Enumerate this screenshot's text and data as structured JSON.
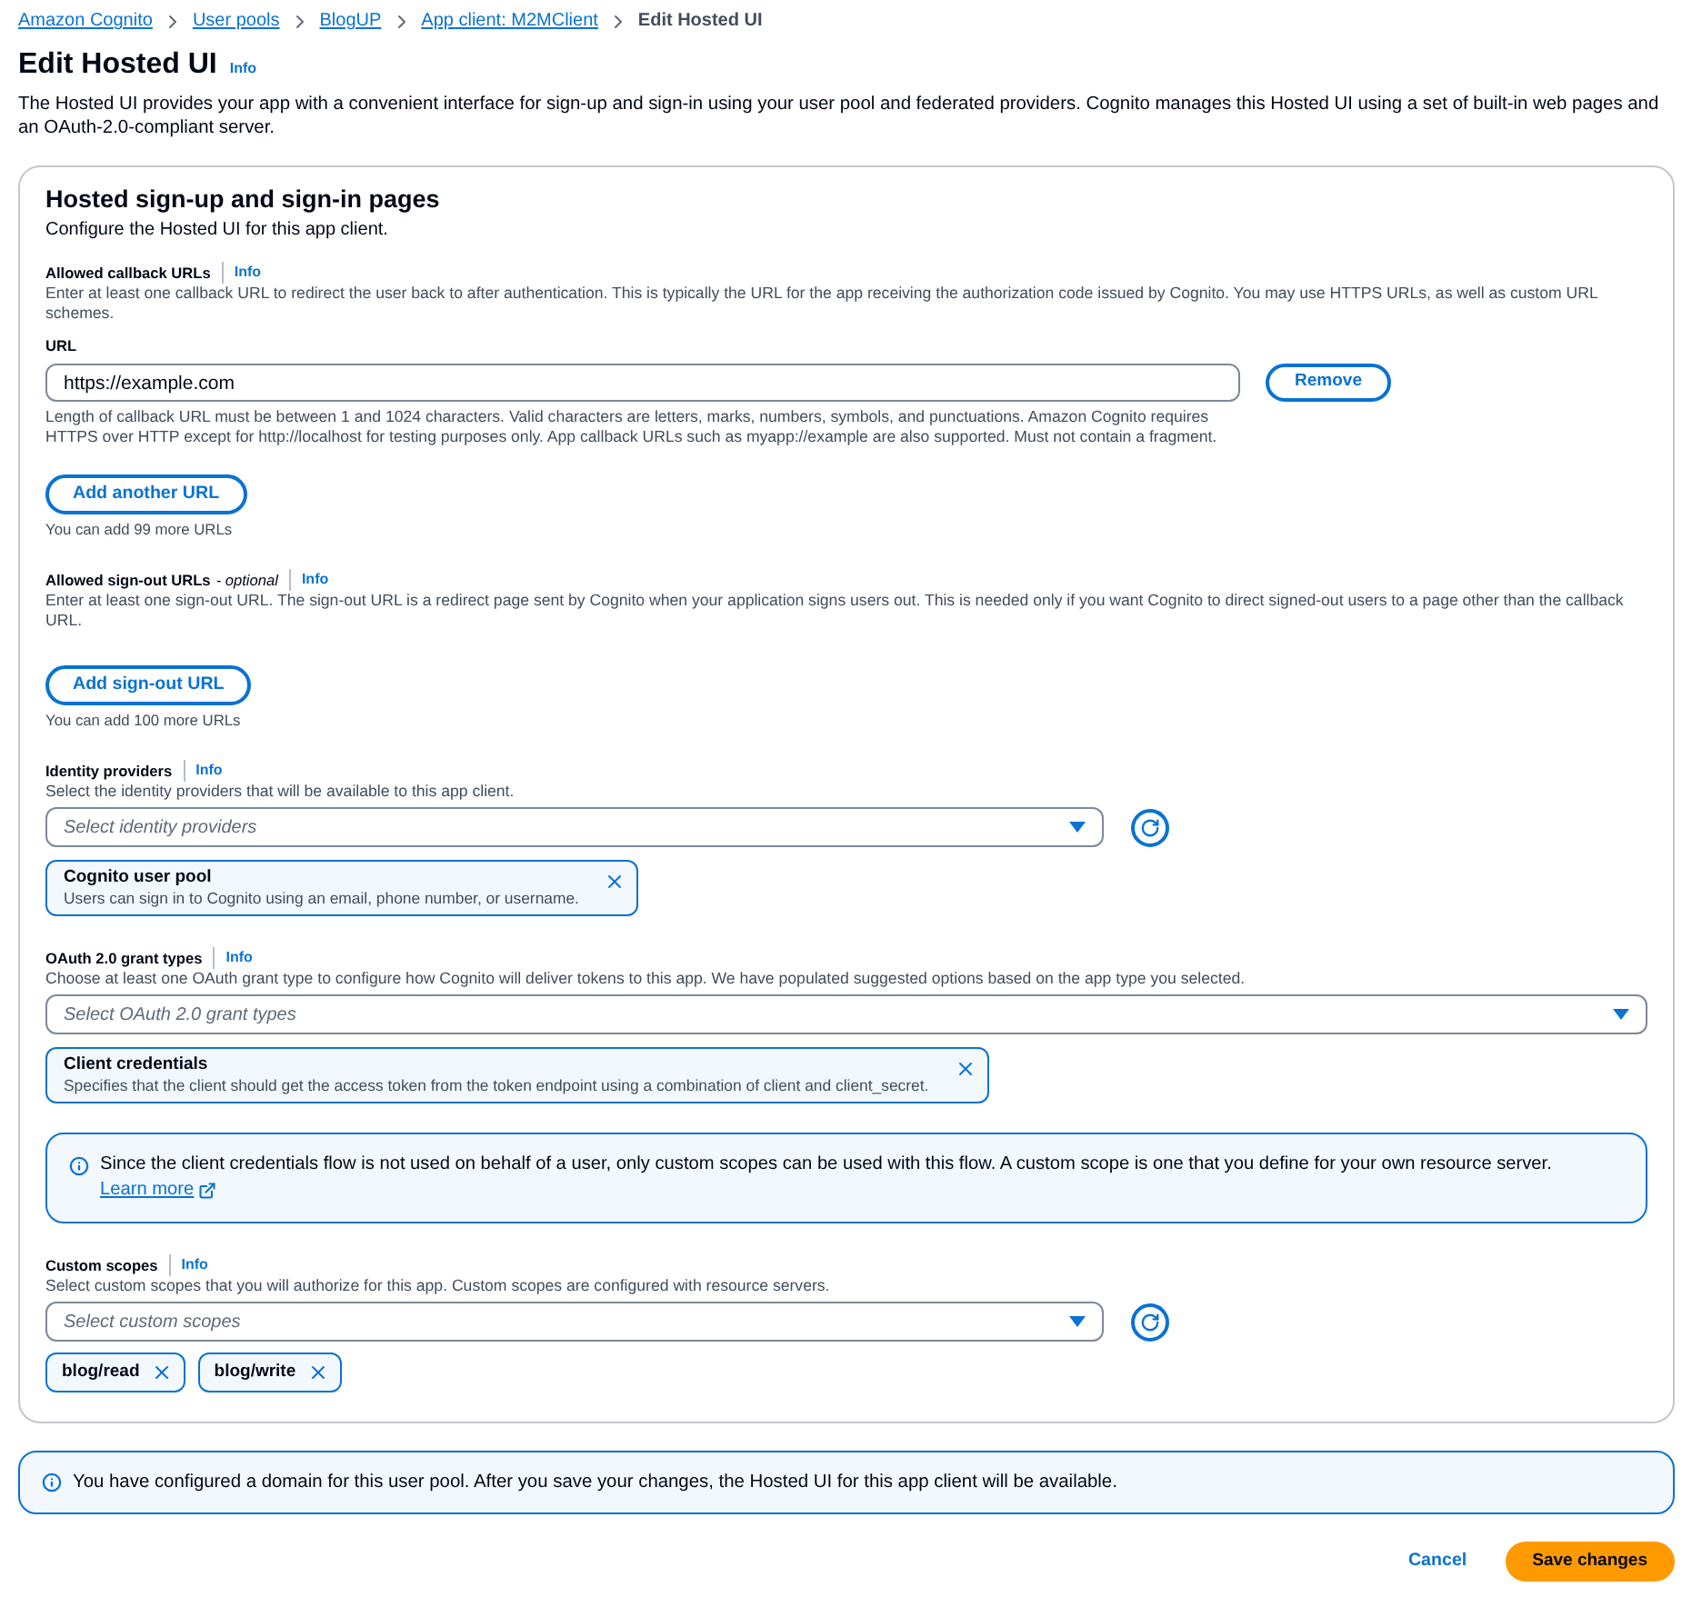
{
  "breadcrumbs": [
    {
      "label": "Amazon Cognito",
      "current": false
    },
    {
      "label": "User pools",
      "current": false
    },
    {
      "label": "BlogUP",
      "current": false
    },
    {
      "label": "App client: M2MClient",
      "current": false
    },
    {
      "label": "Edit Hosted UI",
      "current": true
    }
  ],
  "header": {
    "title": "Edit Hosted UI",
    "info": "Info",
    "description": "The Hosted UI provides your app with a convenient interface for sign-up and sign-in using your user pool and federated providers. Cognito manages this Hosted UI using a set of built-in web pages and an OAuth-2.0-compliant server."
  },
  "panel": {
    "title": "Hosted sign-up and sign-in pages",
    "description": "Configure the Hosted UI for this app client.",
    "sections": [
      {
        "kind": "urls",
        "label": "Allowed callback URLs",
        "info": "Info",
        "description": "Enter at least one callback URL to redirect the user back to after authentication. This is typically the URL for the app receiving the authorization code issued by Cognito. You may use HTTPS URLs, as well as custom URL schemes.",
        "entries": [
          {
            "label": "URL",
            "value": "https://example.com",
            "remove": "Remove",
            "constraint": "Length of callback URL must be between 1 and 1024 characters. Valid characters are letters, marks, numbers, symbols, and punctuations. Amazon Cognito requires HTTPS over HTTP except for http://localhost for testing purposes only. App callback URLs such as myapp://example are also supported. Must not contain a fragment."
          }
        ],
        "add_button": "Add another URL",
        "remaining": "You can add 99 more URLs"
      },
      {
        "kind": "urls",
        "label": "Allowed sign-out URLs",
        "optional": "- optional",
        "info": "Info",
        "description": "Enter at least one sign-out URL. The sign-out URL is a redirect page sent by Cognito when your application signs users out. This is needed only if you want Cognito to direct signed-out users to a page other than the callback URL.",
        "add_button": "Add sign-out URL",
        "remaining": "You can add 100 more URLs"
      },
      {
        "kind": "multiselect",
        "label": "Identity providers",
        "info": "Info",
        "description": "Select the identity providers that will be available to this app client.",
        "placeholder": "Select identity providers",
        "refresh": true,
        "tokens": [
          {
            "title": "Cognito user pool",
            "description": "Users can sign in to Cognito using an email, phone number, or username."
          }
        ]
      },
      {
        "kind": "multiselect",
        "label": "OAuth 2.0 grant types",
        "info": "Info",
        "description": "Choose at least one OAuth grant type to configure how Cognito will deliver tokens to this app. We have populated suggested options based on the app type you selected.",
        "placeholder": "Select OAuth 2.0 grant types",
        "refresh": false,
        "tokens": [
          {
            "title": "Client credentials",
            "description": "Specifies that the client should get the access token from the token endpoint using a combination of client and client_secret."
          }
        ],
        "alert": {
          "text": "Since the client credentials flow is not used on behalf of a user, only custom scopes can be used with this flow. A custom scope is one that you define for your own resource server.",
          "link": "Learn more"
        }
      },
      {
        "kind": "multiselect",
        "label": "Custom scopes",
        "info": "Info",
        "description": "Select custom scopes that you will authorize for this app. Custom scopes are configured with resource servers.",
        "placeholder": "Select custom scopes",
        "refresh": true,
        "tokens": [
          {
            "title": "blog/read"
          },
          {
            "title": "blog/write"
          }
        ]
      }
    ]
  },
  "notice": {
    "text": "You have configured a domain for this user pool. After you save your changes, the Hosted UI for this app client will be available."
  },
  "actions": [
    {
      "label": "Cancel",
      "kind": "link"
    },
    {
      "label": "Save changes",
      "kind": "primary"
    }
  ]
}
